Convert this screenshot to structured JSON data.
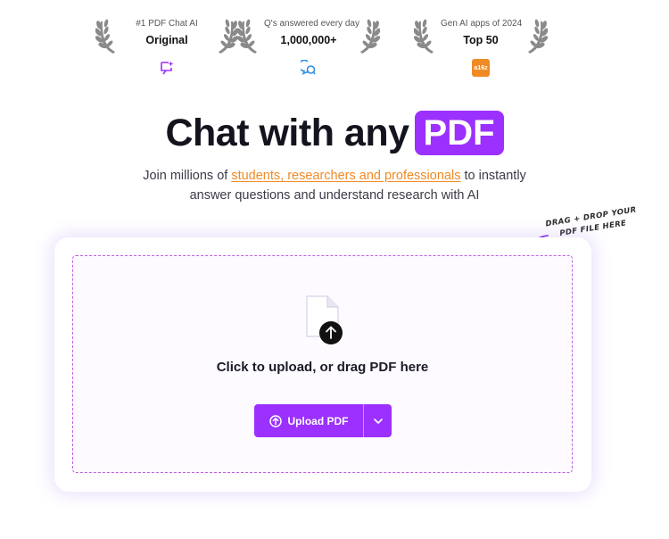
{
  "awards": [
    {
      "caption": "#1 PDF Chat AI",
      "value": "Original",
      "badge_icon": "sparkle-chat-icon",
      "badge_color": "#9b30ff"
    },
    {
      "caption": "Q's answered every day",
      "value": "1,000,000+",
      "badge_icon": "chat-bubbles-icon",
      "badge_color": "#2f8fe8"
    },
    {
      "caption": "Gen AI apps of 2024",
      "value": "Top 50",
      "badge_icon": "a16z-logo",
      "badge_text": "a16z",
      "badge_color": "#f08a24"
    }
  ],
  "hero": {
    "title": "Chat with any",
    "title_highlight": "PDF",
    "subtitle_prefix": "Join millions of ",
    "subtitle_link": "students, researchers and professionals",
    "subtitle_suffix": " to instantly",
    "subtitle_line2": "answer questions and understand research with AI"
  },
  "drag_note": {
    "line1": "DRAG + DROP YOUR",
    "line2": "PDF FILE HERE"
  },
  "upload": {
    "prompt": "Click to upload, or drag PDF here",
    "button_label": "Upload PDF",
    "accent": "#9b30ff"
  }
}
